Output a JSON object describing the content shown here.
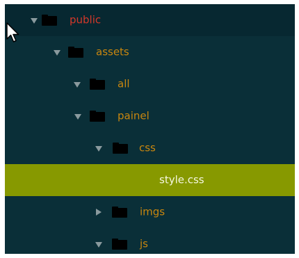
{
  "explorer": {
    "root": {
      "label": "public",
      "expanded": true,
      "icon": "folder-icon"
    },
    "items": [
      {
        "label": "assets",
        "expanded": true,
        "icon": "folder-icon"
      },
      {
        "label": "all",
        "expanded": true,
        "icon": "folder-icon"
      },
      {
        "label": "painel",
        "expanded": true,
        "icon": "folder-icon"
      },
      {
        "label": "css",
        "expanded": true,
        "icon": "folder-icon"
      },
      {
        "label": "style.css",
        "selected": true
      },
      {
        "label": "imgs",
        "expanded": false,
        "icon": "folder-icon"
      },
      {
        "label": "js",
        "expanded": true,
        "icon": "folder-icon"
      }
    ]
  },
  "colors": {
    "panel_background": "#0a2f38",
    "selection": "#879900",
    "folder_text": "#c8860f",
    "root_text": "#d3382a",
    "file_text": "#f5f7e0"
  },
  "pointer": {
    "icon": "mouse-cursor-icon"
  }
}
